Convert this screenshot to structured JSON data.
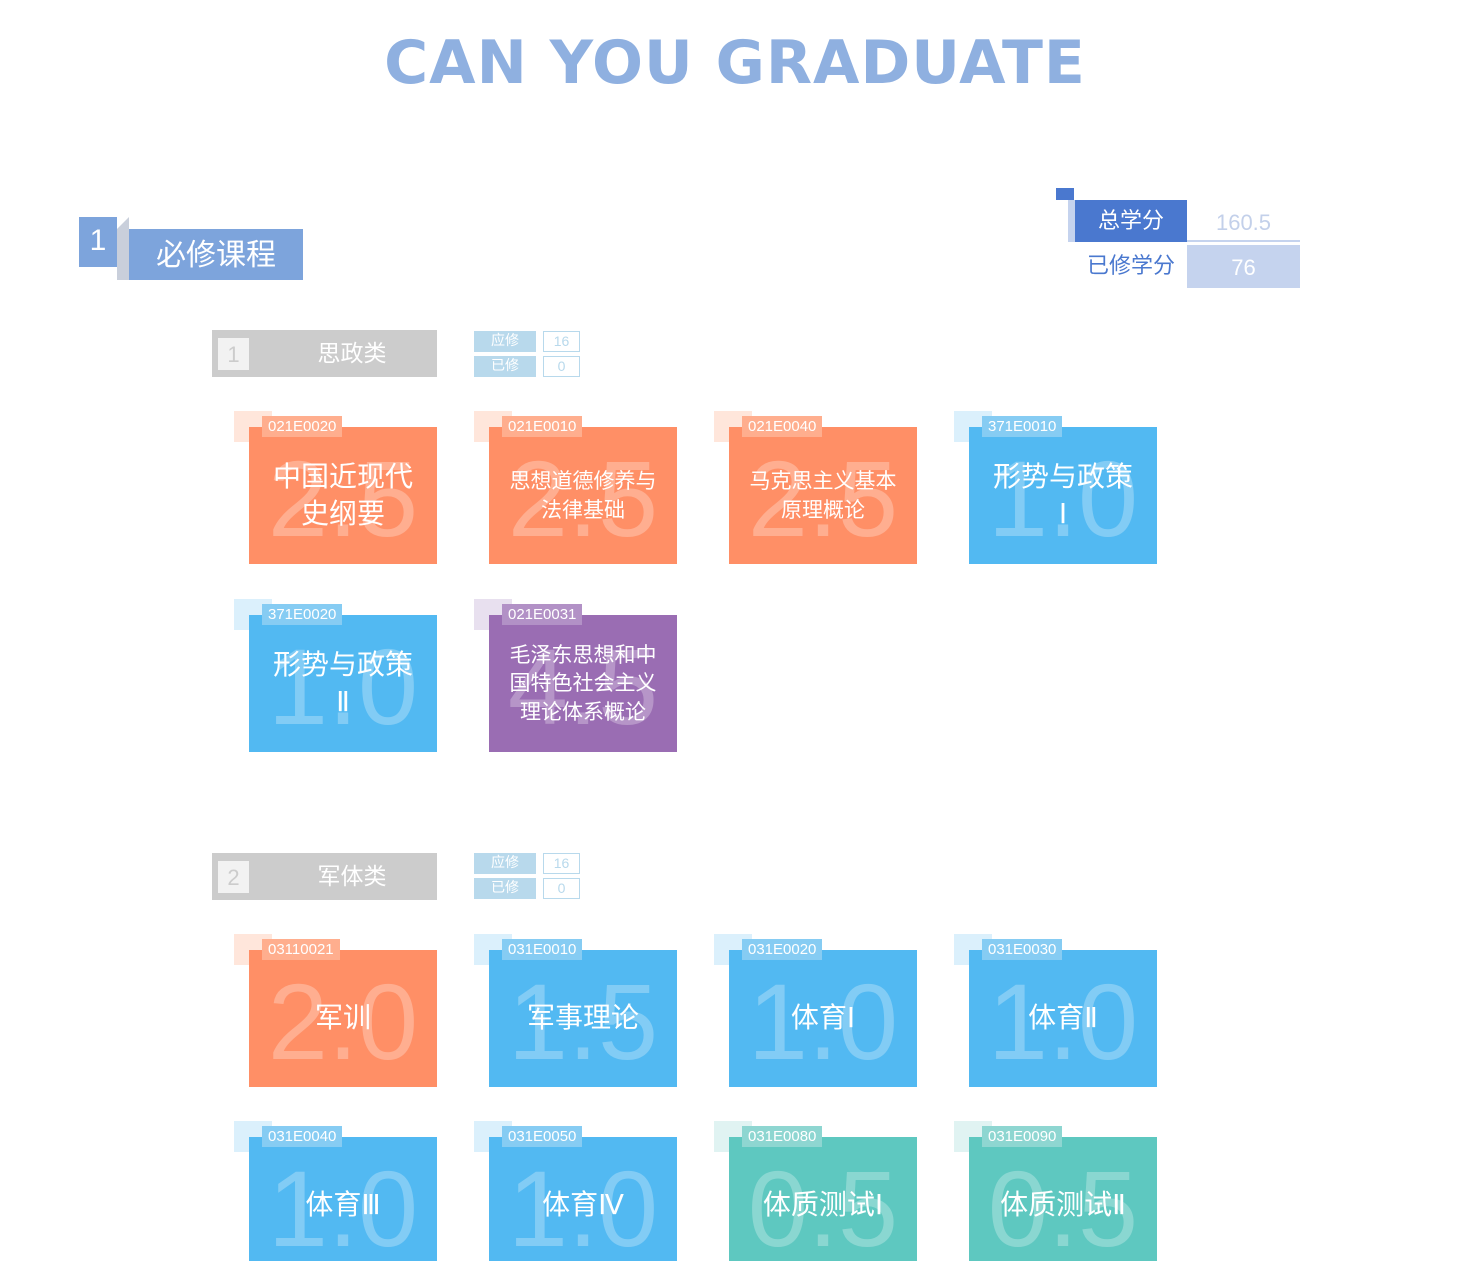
{
  "title": "CAN YOU GRADUATE",
  "section": {
    "num": "1",
    "label": "必修课程"
  },
  "credits": {
    "total_label": "总学分",
    "total_value": "160.5",
    "done_label": "已修学分",
    "done_value": "76"
  },
  "categories": [
    {
      "num": "1",
      "name": "思政类",
      "required_label": "应修",
      "required_value": "16",
      "done_label": "已修",
      "done_value": "0",
      "courses": [
        {
          "code": "021E0020",
          "name": "中国近现代\n史纲要",
          "credit": "2.5",
          "color": "orange"
        },
        {
          "code": "021E0010",
          "name": "思想道德修养与\n法律基础",
          "credit": "2.5",
          "color": "orange"
        },
        {
          "code": "021E0040",
          "name": "马克思主义基本\n原理概论",
          "credit": "2.5",
          "color": "orange"
        },
        {
          "code": "371E0010",
          "name": "形势与政策\nⅠ",
          "credit": "1.0",
          "color": "blue"
        },
        {
          "code": "371E0020",
          "name": "形势与政策\nⅡ",
          "credit": "1.0",
          "color": "blue"
        },
        {
          "code": "021E0031",
          "name": "毛泽东思想和中\n国特色社会主义\n理论体系概论",
          "credit": "4.5",
          "color": "purple"
        }
      ]
    },
    {
      "num": "2",
      "name": "军体类",
      "required_label": "应修",
      "required_value": "16",
      "done_label": "已修",
      "done_value": "0",
      "courses": [
        {
          "code": "03110021",
          "name": "军训",
          "credit": "2.0",
          "color": "orange"
        },
        {
          "code": "031E0010",
          "name": "军事理论",
          "credit": "1.5",
          "color": "blue"
        },
        {
          "code": "031E0020",
          "name": "体育Ⅰ",
          "credit": "1.0",
          "color": "blue"
        },
        {
          "code": "031E0030",
          "name": "体育Ⅱ",
          "credit": "1.0",
          "color": "blue"
        },
        {
          "code": "031E0040",
          "name": "体育Ⅲ",
          "credit": "1.0",
          "color": "blue"
        },
        {
          "code": "031E0050",
          "name": "体育Ⅳ",
          "credit": "1.0",
          "color": "blue"
        },
        {
          "code": "031E0080",
          "name": "体质测试Ⅰ",
          "credit": "0.5",
          "color": "teal"
        },
        {
          "code": "031E0090",
          "name": "体质测试Ⅱ",
          "credit": "0.5",
          "color": "teal"
        }
      ]
    }
  ]
}
